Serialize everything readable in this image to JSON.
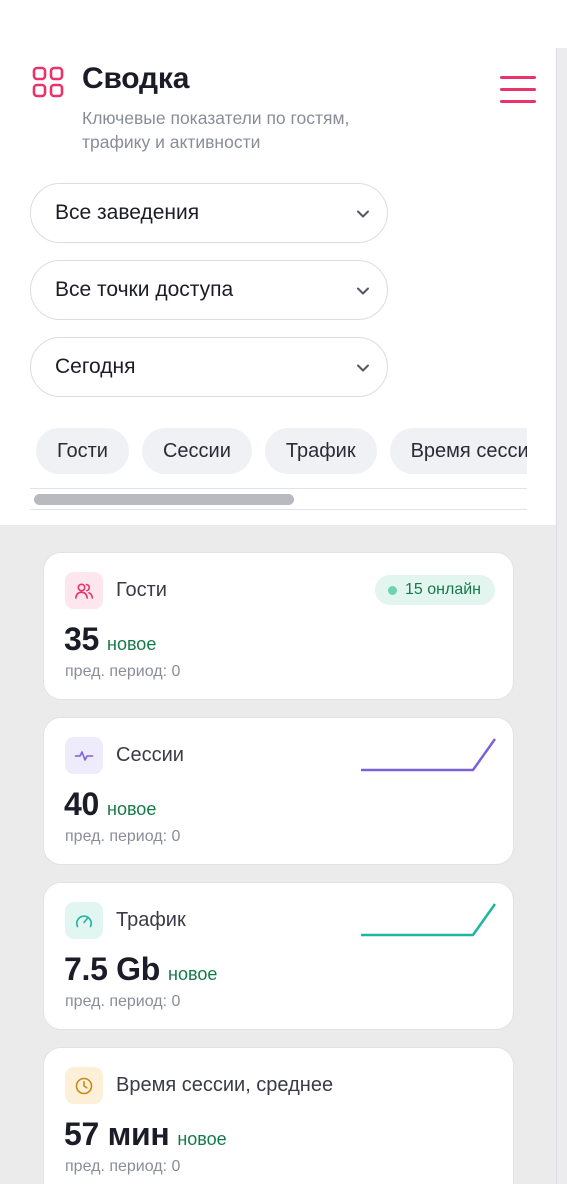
{
  "header": {
    "title": "Сводка",
    "subtitle": "Ключевые показатели по гостям, трафику и активности",
    "title_icon": "grid-icon",
    "menu_icon": "hamburger-menu-icon",
    "accent_color": "#e8336b"
  },
  "filters": {
    "venue": "Все заведения",
    "access_point": "Все точки доступа",
    "period": "Сегодня"
  },
  "tabs": [
    "Гости",
    "Сессии",
    "Трафик",
    "Время сессии"
  ],
  "cards": {
    "guests": {
      "name": "Гости",
      "value": "35",
      "delta": "новое",
      "prev": "пред. период: 0",
      "online": "15 онлайн",
      "icon": "users-icon",
      "color": "#e8336b"
    },
    "sessions": {
      "name": "Сессии",
      "value": "40",
      "delta": "новое",
      "prev": "пред. период: 0",
      "icon": "activity-pulse-icon",
      "color": "#7c62d8"
    },
    "traffic": {
      "name": "Трафик",
      "value": "7.5 Gb",
      "delta": "новое",
      "prev": "пред. период: 0",
      "icon": "speedometer-icon",
      "color": "#1fb5a0"
    },
    "session_time": {
      "name": "Время сессии, среднее",
      "value": "57 мин",
      "delta": "новое",
      "prev": "пред. период: 0",
      "icon": "clock-icon",
      "color": "#c98a12"
    }
  }
}
